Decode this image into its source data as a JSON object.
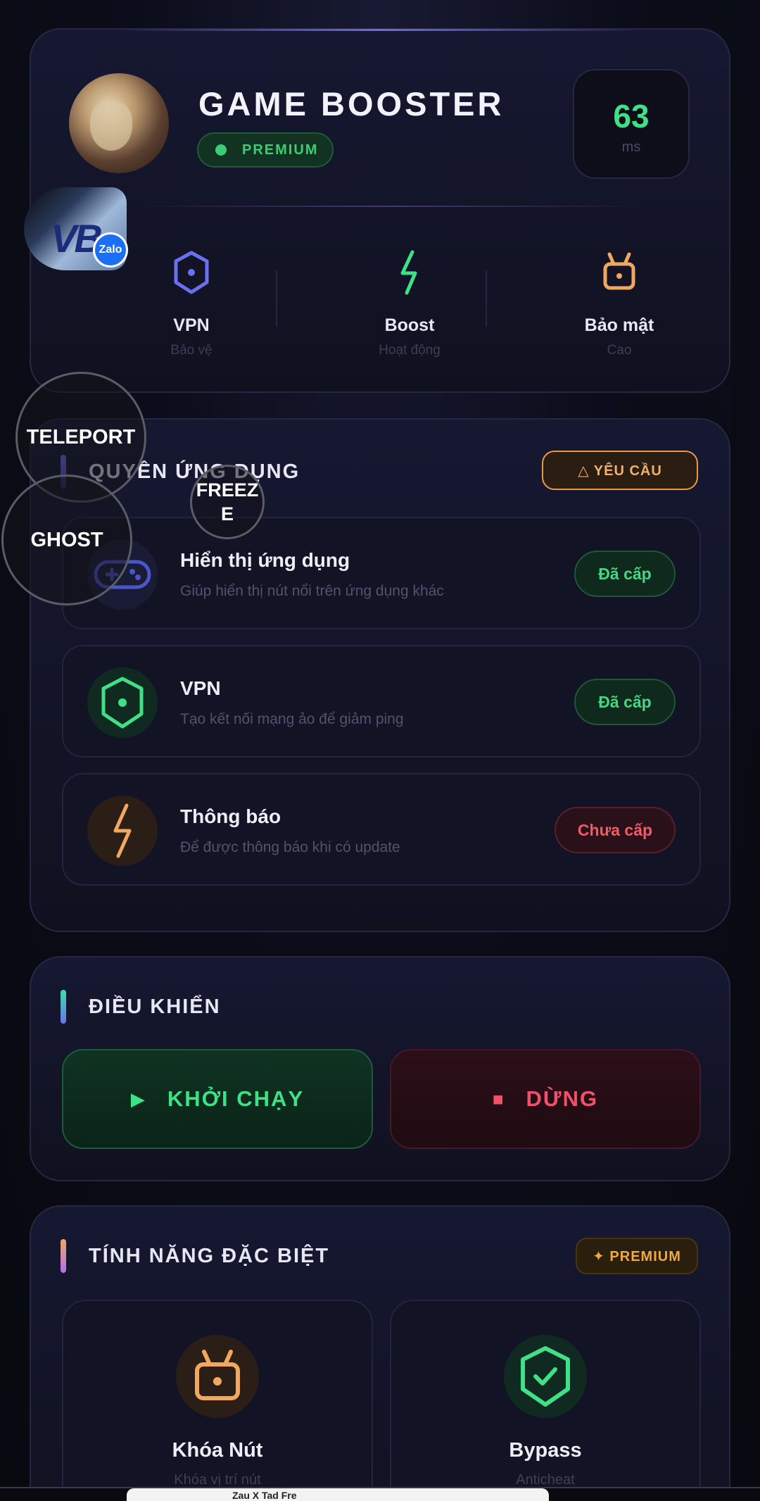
{
  "header": {
    "app_title": "GAME BOOSTER",
    "premium_label": "PREMIUM",
    "ping_value": "63",
    "ping_unit": "ms",
    "stats": [
      {
        "label": "VPN",
        "sub": "Bảo vệ",
        "icon": "shield-icon",
        "color": "#6b70f0"
      },
      {
        "label": "Boost",
        "sub": "Hoạt động",
        "icon": "bolt-icon",
        "color": "#3fe086"
      },
      {
        "label": "Bảo mật",
        "sub": "Cao",
        "icon": "lock-icon",
        "color": "#f0a860"
      }
    ]
  },
  "permissions": {
    "title": "QUYỀN ỨNG DỤNG",
    "request_button": "△ YÊU CẦU",
    "items": [
      {
        "title": "Hiển thị ứng dụng",
        "sub": "Giúp hiển thị nút nổi trên ứng dụng khác",
        "status": "Đã cấp",
        "granted": true,
        "icon": "gamepad-icon"
      },
      {
        "title": "VPN",
        "sub": "Tạo kết nối mạng ảo để giảm ping",
        "status": "Đã cấp",
        "granted": true,
        "icon": "shield-icon"
      },
      {
        "title": "Thông báo",
        "sub": "Để được thông báo khi có update",
        "status": "Chưa cấp",
        "granted": false,
        "icon": "bolt-icon"
      }
    ]
  },
  "control": {
    "title": "ĐIỀU KHIỂN",
    "start_label": "KHỞI CHẠY",
    "stop_label": "DỪNG"
  },
  "features": {
    "title": "TÍNH NĂNG ĐẶC BIỆT",
    "premium_tag": "✦ PREMIUM",
    "items": [
      {
        "title": "Khóa Nút",
        "sub": "Khóa vị trí nút",
        "icon": "lock-icon"
      },
      {
        "title": "Bypass",
        "sub": "Anticheat",
        "icon": "shield-check-icon"
      }
    ]
  },
  "overlays": {
    "teleport": "TELEPORT",
    "ghost": "GHOST",
    "freeze": "FREEZ\nE",
    "zalo_badge": "Zalo",
    "zalo_bubble_text": "VB"
  },
  "bottom_bar": {
    "text": "Zau X Tad Fre"
  },
  "colors": {
    "accent_green": "#3fe086",
    "accent_red": "#f0506a",
    "accent_orange": "#f0a860",
    "accent_purple": "#6b70f0"
  }
}
